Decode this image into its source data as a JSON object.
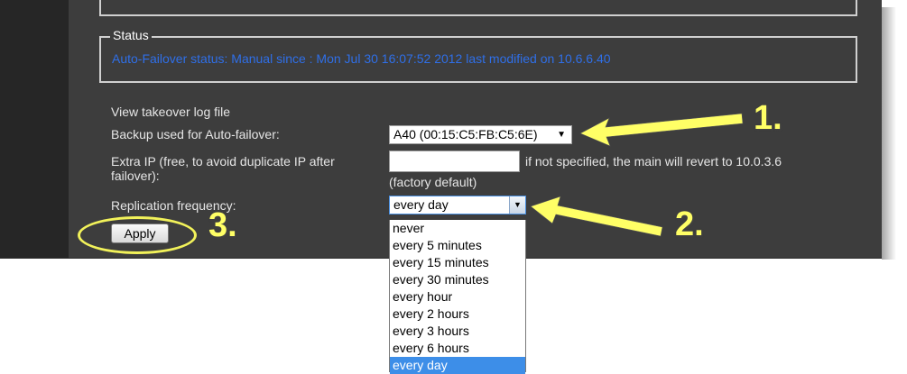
{
  "status": {
    "legend": "Status",
    "text": "Auto-Failover status: Manual since : Mon Jul 30 16:07:52 2012 last modified on 10.6.6.40"
  },
  "form": {
    "view_log_label": "View takeover log file",
    "backup_label": "Backup used for Auto-failover:",
    "backup_value": "A40 (00:15:C5:FB:C5:6E)",
    "extra_ip_label_line1": "Extra IP (free, to avoid duplicate IP after",
    "extra_ip_label_line2": "failover):",
    "extra_ip_value": "",
    "extra_ip_hint_line1": "if not specified, the main will revert to 10.0.3.6",
    "extra_ip_hint_line2": "(factory default)",
    "replication_label": "Replication frequency:",
    "replication_value": "every day",
    "replication_options": [
      "never",
      "every 5 minutes",
      "every 15 minutes",
      "every 30 minutes",
      "every hour",
      "every 2 hours",
      "every 3 hours",
      "every 6 hours",
      "every day"
    ],
    "apply_label": "Apply"
  },
  "annotations": {
    "step1": "1.",
    "step2": "2.",
    "step3": "3.",
    "color": "#ffff66"
  }
}
